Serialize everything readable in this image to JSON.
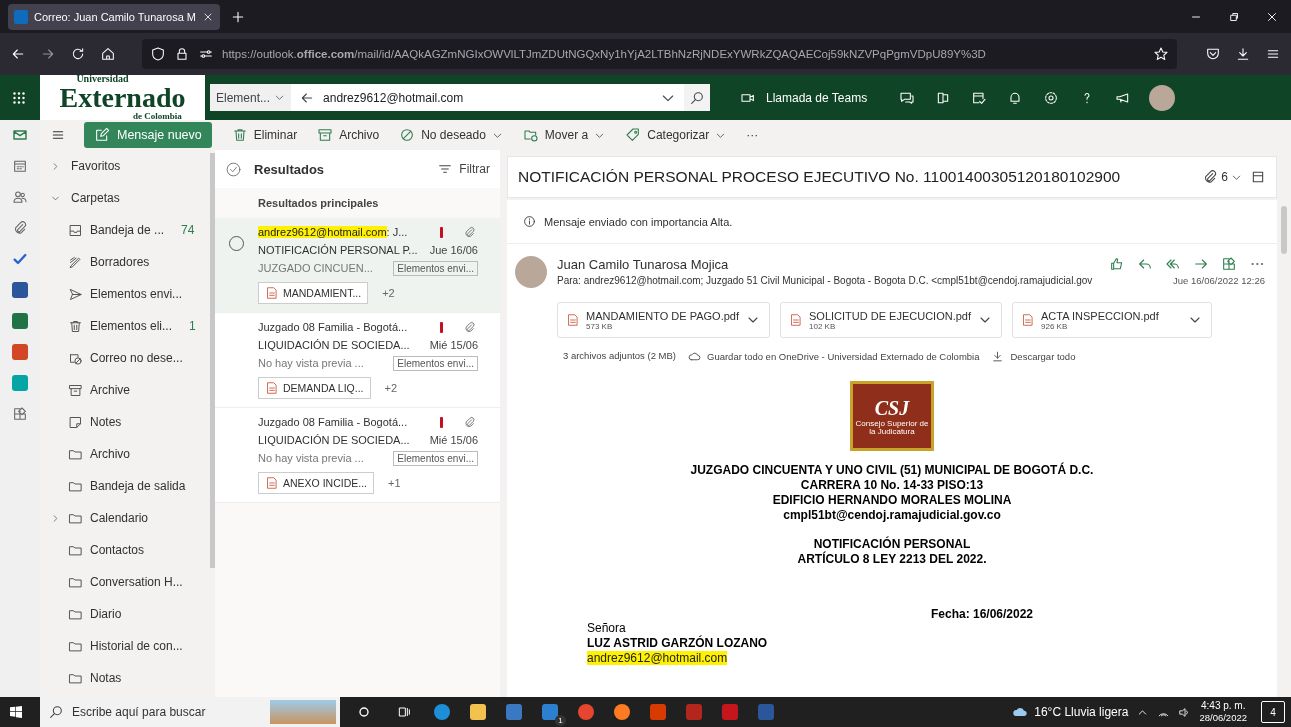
{
  "browser": {
    "tab_title": "Correo: Juan Camilo Tunarosa M",
    "url": "https://outlook.**office.com**/mail/id/AAQkAGZmNGIxOWVlLTJmZDUtNGQxNy1hYjA2LTBhNzRjNDExYWRkZQAQAECoj59kNZVPqPgmVDpU89Y%3D"
  },
  "header": {
    "logo_top": "Universidad",
    "logo_main": "Externado",
    "logo_bottom": "de Colombia",
    "search_scope": "Element...",
    "search_value": "andrez9612@hotmail.com",
    "teams_label": "Llamada de Teams"
  },
  "commands": {
    "new_message": "Mensaje nuevo",
    "actions": [
      {
        "kind": "trash",
        "label": "Eliminar",
        "menu": false
      },
      {
        "kind": "archive",
        "label": "Archivo",
        "menu": false
      },
      {
        "kind": "block",
        "label": "No deseado",
        "menu": true
      },
      {
        "kind": "move",
        "label": "Mover a",
        "menu": true
      },
      {
        "kind": "tag",
        "label": "Categorizar",
        "menu": true
      }
    ],
    "more": "···"
  },
  "rail": [
    {
      "kind": "mail",
      "selected": true
    },
    {
      "kind": "calendar",
      "selected": false
    },
    {
      "kind": "people",
      "selected": false
    },
    {
      "kind": "clip",
      "selected": false
    },
    {
      "kind": "todo",
      "selected": false
    },
    {
      "kind": "word",
      "selected": false
    },
    {
      "kind": "excel",
      "selected": false
    },
    {
      "kind": "powerpoint",
      "selected": false
    },
    {
      "kind": "bookings",
      "selected": false
    },
    {
      "kind": "apps",
      "selected": false
    }
  ],
  "folders": [
    {
      "label": "Favoritos",
      "expanded": false
    },
    {
      "label": "Carpetas",
      "expanded": true,
      "children": [
        {
          "kind": "inbox",
          "label": "Bandeja de ...",
          "count": "74",
          "expandable": false
        },
        {
          "kind": "draft",
          "label": "Borradores",
          "expandable": false
        },
        {
          "kind": "send",
          "label": "Elementos envi...",
          "expandable": false
        },
        {
          "kind": "trash",
          "label": "Elementos eli...",
          "count": "1",
          "expandable": false
        },
        {
          "kind": "junk",
          "label": "Correo no dese...",
          "expandable": false
        },
        {
          "kind": "archive",
          "label": "Archive",
          "expandable": false
        },
        {
          "kind": "note",
          "label": "Notes",
          "expandable": false
        },
        {
          "kind": "folder",
          "label": "Archivo",
          "expandable": false
        },
        {
          "kind": "folder",
          "label": "Bandeja de salida",
          "expandable": false
        },
        {
          "kind": "folder",
          "label": "Calendario",
          "expandable": true
        },
        {
          "kind": "folder",
          "label": "Contactos",
          "expandable": false
        },
        {
          "kind": "folder",
          "label": "Conversation H...",
          "expandable": false
        },
        {
          "kind": "folder",
          "label": "Diario",
          "expandable": false
        },
        {
          "kind": "folder",
          "label": "Historial de con...",
          "expandable": false
        },
        {
          "kind": "folder",
          "label": "Notas",
          "expandable": false
        }
      ]
    }
  ],
  "message_list": {
    "title": "Resultados",
    "filter": "Filtrar",
    "section": "Resultados principales",
    "messages": [
      {
        "selected": true,
        "sender_match": "andrez9612@hotmail.com",
        "sender": ": J...",
        "important": true,
        "attachment": true,
        "subject": "NOTIFICACIÓN PERSONAL P...",
        "date": "Jue 16/06",
        "preview": "JUZGADO CINCUEN...",
        "folder_tag": "Elementos envi...",
        "file": "MANDAMIENT...",
        "more_files": "+2"
      },
      {
        "selected": false,
        "sender": "Juzgado 08 Familia - Bogotá...",
        "important": true,
        "attachment": true,
        "subject": "LIQUIDACIÓN DE SOCIEDA...",
        "date": "Mié 15/06",
        "preview": "No hay vista previa ...",
        "folder_tag": "Elementos envi...",
        "file": "DEMANDA LIQ...",
        "more_files": "+2"
      },
      {
        "selected": false,
        "sender": "Juzgado 08 Familia - Bogotá...",
        "important": true,
        "attachment": true,
        "subject": "LIQUIDACIÓN DE SOCIEDA...",
        "date": "Mié 15/06",
        "preview": "No hay vista previa ...",
        "folder_tag": "Elementos envi...",
        "file": "ANEXO INCIDE...",
        "more_files": "+1"
      }
    ]
  },
  "reading": {
    "subject": "NOTIFICACIÓN PERSONAL PROCESO EJECUTIVO No. 11001400305120180102900",
    "attachment_count": "6",
    "importance_note": "Mensaje enviado con importancia Alta.",
    "sender": "Juan Camilo Tunarosa Mojica",
    "to": "Para: andrez9612@hotmail.com;  Juzgado 51 Civil Municipal - Bogota - Bogota D.C. <cmpl51bt@cendoj.ramajudicial.gov",
    "datetime": "Jue 16/06/2022 12:26",
    "attachments": [
      {
        "name": "MANDAMIENTO DE PAGO.pdf",
        "size": "573 KB"
      },
      {
        "name": "SOLICITUD DE EJECUCION.pdf",
        "size": "102 KB"
      },
      {
        "name": "ACTA INSPECCION.pdf",
        "size": "926 KB"
      }
    ],
    "attachments_summary": "3 archivos adjuntos (2 MB)",
    "save_all": "Guardar todo en OneDrive - Universidad Externado de Colombia",
    "download_all": "Descargar todo",
    "letter": {
      "logo_text": "CSJ",
      "logo_caption": "Consejo Superior de la Judicatura",
      "heading": [
        "JUZGADO CINCUENTA Y UNO CIVIL (51) MUNICIPAL DE BOGOTÁ D.C.",
        "CARRERA 10 No. 14-33 PISO:13",
        "EDIFICIO HERNANDO MORALES MOLINA",
        "cmpl51bt@cendoj.ramajudicial.gov.co"
      ],
      "notice": [
        "NOTIFICACIÓN PERSONAL",
        "ARTÍCULO 8 LEY 2213 DEL 2022."
      ],
      "date": "Fecha: 16/06/2022",
      "salutation": "Señora",
      "addressee": "LUZ ASTRID GARZÓN LOZANO",
      "email": "andrez9612@hotmail.com"
    }
  },
  "taskbar": {
    "search_placeholder": "Escribe aquí para buscar",
    "mail_badge": "1",
    "weather": "16°C Lluvia ligera",
    "time": "4:43 p. m.",
    "date": "28/06/2022",
    "notifications": "4"
  }
}
